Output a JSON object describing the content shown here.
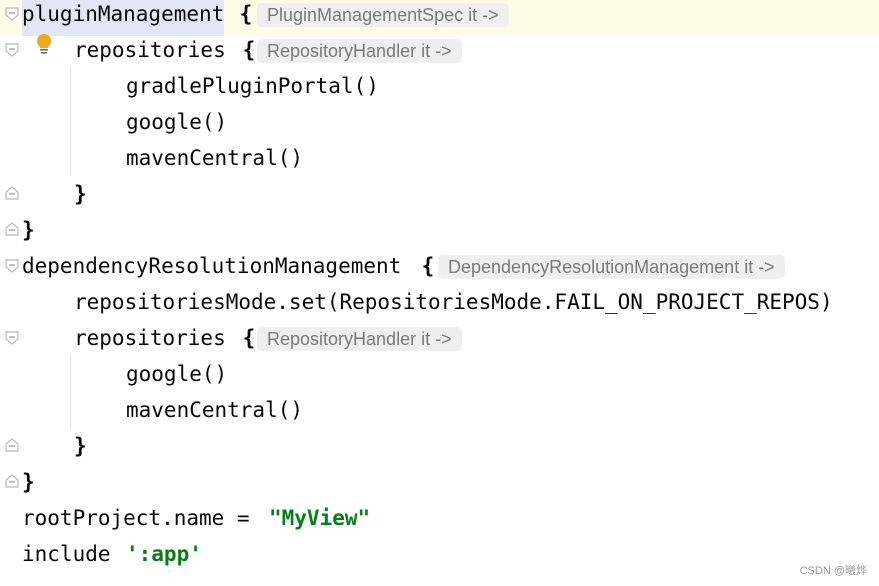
{
  "editor": {
    "lines": [
      {
        "code": "pluginManagement",
        "brace": " {",
        "hint": "PluginManagementSpec it ->"
      },
      {
        "code": "repositories",
        "brace": " {",
        "hint": "RepositoryHandler it ->"
      },
      {
        "code": "gradlePluginPortal()"
      },
      {
        "code": "google()"
      },
      {
        "code": "mavenCentral()"
      },
      {
        "code": "}"
      },
      {
        "code": "}"
      },
      {
        "code": "dependencyResolutionManagement",
        "brace": " {",
        "hint": "DependencyResolutionManagement it ->"
      },
      {
        "code": "repositoriesMode.set(RepositoriesMode.FAIL_ON_PROJECT_REPOS)"
      },
      {
        "code": "repositories",
        "brace": " {",
        "hint": "RepositoryHandler it ->"
      },
      {
        "code": "google()"
      },
      {
        "code": "mavenCentral()"
      },
      {
        "code": "}"
      },
      {
        "code": "}"
      },
      {
        "code": "rootProject.name = ",
        "string": "\"MyView\""
      },
      {
        "code": "include ",
        "string": "':app'"
      }
    ]
  },
  "icons": {
    "fold_start": "fold-start-icon",
    "fold_end": "fold-end-icon",
    "intention": "lightbulb-icon"
  },
  "colors": {
    "string": "#067d17",
    "hint_background": "#efefef",
    "hint_text": "#7a7a7a",
    "current_line": "#fefbe7",
    "identifier_highlight": "#e5e5f8"
  },
  "watermark": "CSDN @曦烨"
}
